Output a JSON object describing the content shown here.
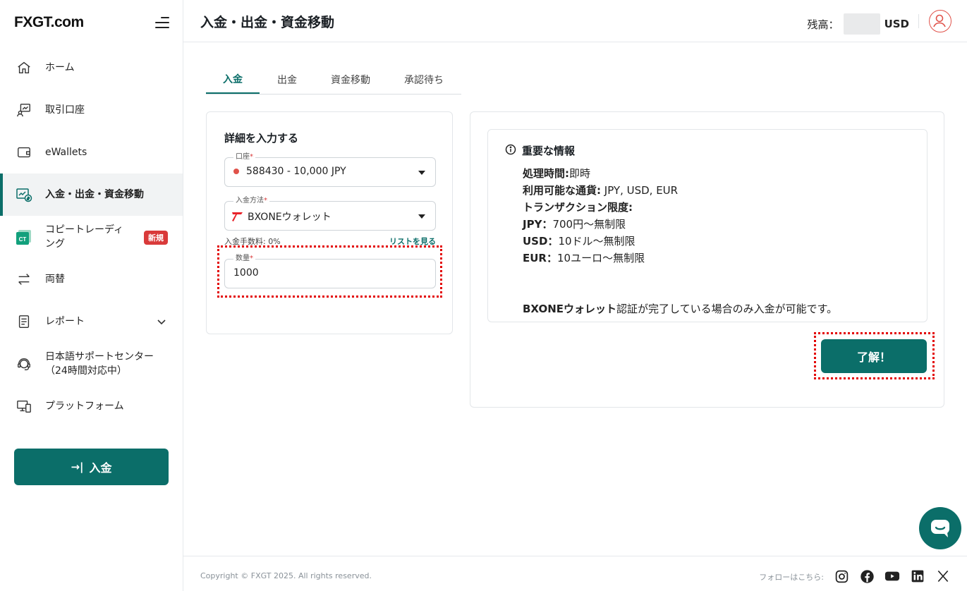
{
  "brand": {
    "logo_fx": "FXGT",
    "logo_suffix": ".com"
  },
  "sidebar": {
    "items": [
      {
        "label": "ホーム",
        "icon": "home-icon"
      },
      {
        "label": "取引口座",
        "icon": "trading-account-icon"
      },
      {
        "label": "eWallets",
        "icon": "wallet-icon"
      },
      {
        "label": "入金・出金・資金移動",
        "icon": "funds-transfer-icon",
        "active": true
      },
      {
        "label": "コピートレーディング",
        "label_line1": "コピートレーディ",
        "label_line2": "ング",
        "icon": "copy-trading-icon",
        "badge": "新規"
      },
      {
        "label": "両替",
        "icon": "exchange-icon"
      },
      {
        "label": "レポート",
        "icon": "report-icon"
      },
      {
        "label_line1": "日本語サポートセンター",
        "label_line2": "（24時間対応中）",
        "icon": "support-headset-icon"
      },
      {
        "label": "プラットフォーム",
        "icon": "platform-icon"
      }
    ],
    "deposit_button": "入金",
    "copy_trading_icon_text": "CT"
  },
  "header": {
    "title": "入金・出金・資金移動",
    "balance_label": "残高：",
    "balance_currency": "USD"
  },
  "tabs": [
    {
      "label": "入金",
      "active": true
    },
    {
      "label": "出金"
    },
    {
      "label": "資金移動"
    },
    {
      "label": "承認待ち"
    }
  ],
  "form": {
    "title": "詳細を入力する",
    "account_label": "口座",
    "account_value": "588430 - 10,000 JPY",
    "method_label": "入金方法",
    "method_value": "BXONEウォレット",
    "fee_text": "入金手数料: 0%",
    "list_link": "リストを見る",
    "amount_label": "数量",
    "amount_value": "1000",
    "required_mark": "*"
  },
  "info": {
    "heading": "重要な情報",
    "processing_label": "処理時間:",
    "processing_value": "即時",
    "currencies_label": "利用可能な通貨:",
    "currencies_value": " JPY, USD, EUR",
    "limits_label": "トランザクション限度:",
    "jpy_label": "JPY：",
    "jpy_value": "700円～無制限",
    "usd_label": "USD：",
    "usd_value": "10ドル～無制限",
    "eur_label": "EUR：",
    "eur_value": "10ユーロ～無制限",
    "note_bold": "BXONEウォレット",
    "note_rest": "認証が完了している場合のみ入金が可能です。",
    "ok_button": "了解！"
  },
  "footer": {
    "copyright": "Copyright © FXGT 2025. All rights reserved.",
    "follow": "フォローはこちら:",
    "social": [
      "instagram-icon",
      "facebook-icon",
      "youtube-icon",
      "linkedin-icon",
      "x-icon"
    ]
  },
  "colors": {
    "brand_teal": "#0b6e69",
    "badge_red": "#d93a3a",
    "highlight_red": "#e30000"
  }
}
